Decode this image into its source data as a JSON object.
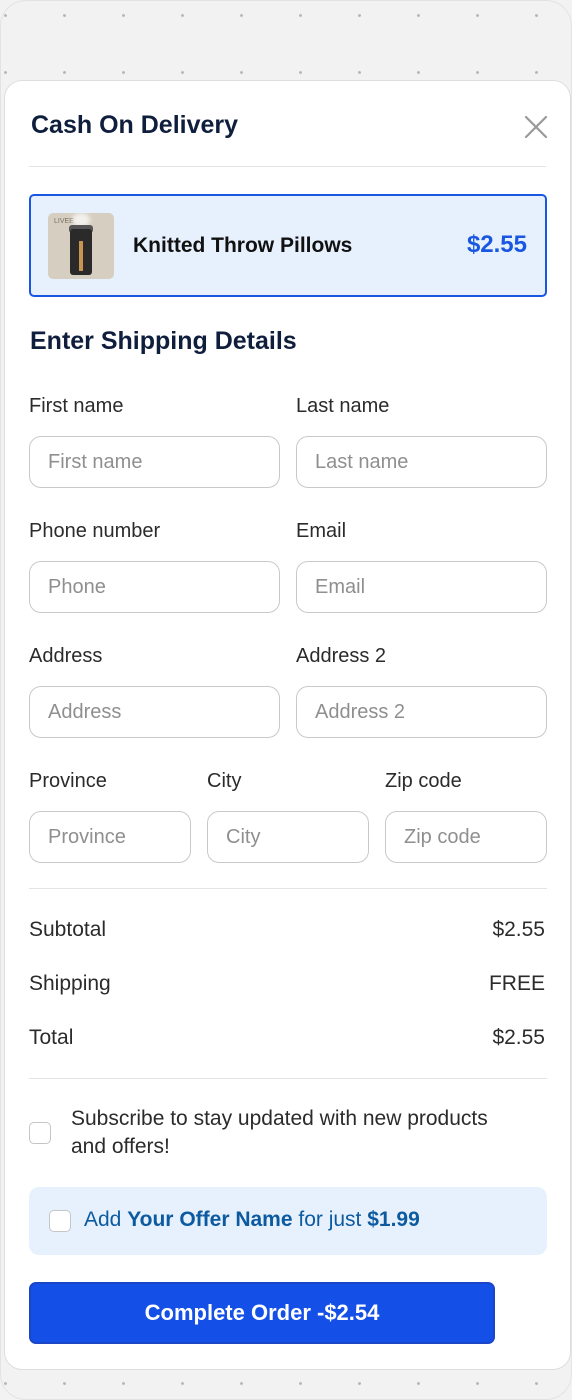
{
  "modal": {
    "title": "Cash On Delivery",
    "close_icon": "close-icon"
  },
  "product": {
    "name": "Knitted Throw Pillows",
    "price": "$2.55",
    "thumb_mark": "LIVEE"
  },
  "shipping": {
    "title": "Enter Shipping Details",
    "fields": {
      "first_name": {
        "label": "First name",
        "placeholder": "First name",
        "value": ""
      },
      "last_name": {
        "label": "Last name",
        "placeholder": "Last name",
        "value": ""
      },
      "phone": {
        "label": "Phone number",
        "placeholder": "Phone",
        "value": ""
      },
      "email": {
        "label": "Email",
        "placeholder": "Email",
        "value": ""
      },
      "address": {
        "label": "Address",
        "placeholder": "Address",
        "value": ""
      },
      "address2": {
        "label": "Address 2",
        "placeholder": "Address 2",
        "value": ""
      },
      "province": {
        "label": "Province",
        "placeholder": "Province",
        "value": ""
      },
      "city": {
        "label": "City",
        "placeholder": "City",
        "value": ""
      },
      "zip": {
        "label": "Zip code",
        "placeholder": "Zip code",
        "value": ""
      }
    }
  },
  "summary": {
    "subtotal_label": "Subtotal",
    "subtotal_value": "$2.55",
    "shipping_label": "Shipping",
    "shipping_value": "FREE",
    "total_label": "Total",
    "total_value": "$2.55"
  },
  "subscribe": {
    "text": "Subscribe to stay updated with new products and offers!",
    "checked": false
  },
  "offer": {
    "prefix": "Add ",
    "name": "Your Offer Name",
    "middle": " for just ",
    "price": "$1.99",
    "checked": false
  },
  "cta": {
    "label": "Complete Order -$2.54"
  },
  "colors": {
    "accent": "#1450e8",
    "price_blue": "#1a57e0",
    "heading": "#0f1e3d",
    "offer_text": "#0c5aa0",
    "highlight_bg": "#e7f1fd"
  }
}
